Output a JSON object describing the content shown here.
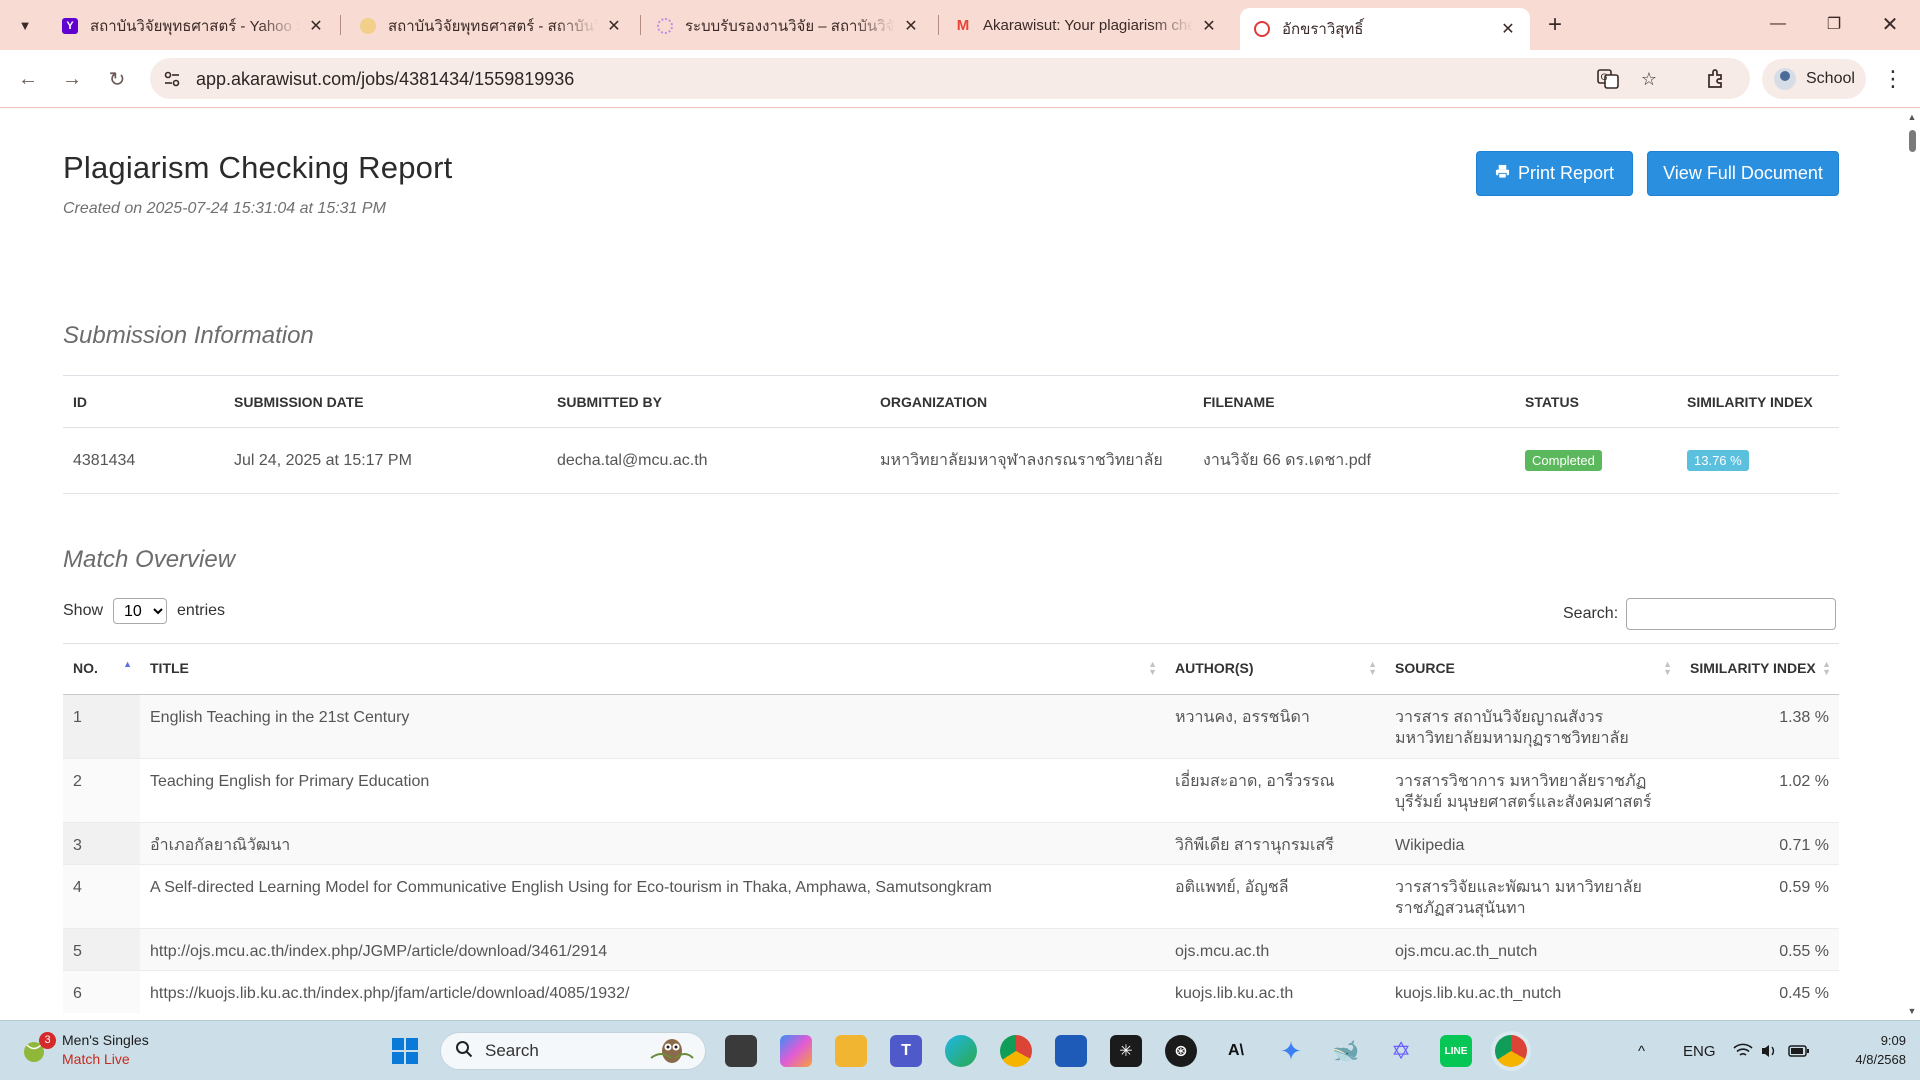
{
  "browser": {
    "tabs": [
      {
        "title": "สถาบันวิจัยพุทธศาสตร์ - Yahoo Sea",
        "favicon": "yahoo-icon",
        "color": "#5f01d1"
      },
      {
        "title": "สถาบันวิจัยพุทธศาสตร์ - สถาบันวิจัยพ",
        "favicon": "temple-icon",
        "color": "#e6b84a"
      },
      {
        "title": "ระบบรับรองงานวิจัย – สถาบันวิจัยพุท",
        "favicon": "flower-icon",
        "color": "#c58be0"
      },
      {
        "title": "Akarawisut: Your plagiarism che",
        "favicon": "gmail-icon",
        "color": "#ea4335"
      },
      {
        "title": "อักขราวิสุทธิ์",
        "favicon": "akarawisut-icon",
        "color": "#e03a3a"
      }
    ],
    "url": "app.akarawisut.com/jobs/4381434/1559819936",
    "profile_label": "School"
  },
  "report": {
    "title": "Plagiarism Checking Report",
    "created": "Created on 2025-07-24 15:31:04 at 15:31 PM",
    "print_button": "Print Report",
    "view_button": "View Full Document"
  },
  "submission": {
    "heading": "Submission Information",
    "headers": [
      "ID",
      "SUBMISSION DATE",
      "SUBMITTED BY",
      "ORGANIZATION",
      "FILENAME",
      "STATUS",
      "SIMILARITY INDEX"
    ],
    "row": {
      "id": "4381434",
      "date": "Jul 24, 2025 at 15:17 PM",
      "submitted_by": "decha.tal@mcu.ac.th",
      "organization": "มหาวิทยาลัยมหาจุฬาลงกรณราชวิทยาลัย",
      "filename": "งานวิจัย 66 ดร.เดชา.pdf",
      "status": "Completed",
      "similarity": "13.76 %"
    },
    "status_color": "#5cb85c",
    "similarity_color": "#5bc0de"
  },
  "overview": {
    "heading": "Match Overview",
    "show_label": "Show",
    "entries_value": "10",
    "entries_label": "entries",
    "search_label": "Search:",
    "headers": [
      "NO.",
      "TITLE",
      "AUTHOR(S)",
      "SOURCE",
      "SIMILARITY INDEX"
    ],
    "rows": [
      {
        "no": "1",
        "title": "English Teaching in the 21st Century",
        "authors": "หวานคง, อรรชนิดา",
        "source": "วารสาร สถาบันวิจัยญาณสังวร มหาวิทยาลัยมหามกุฏราชวิทยาลัย",
        "similarity": "1.38 %"
      },
      {
        "no": "2",
        "title": "Teaching English for Primary Education",
        "authors": "เอี่ยมสะอาด, อารีวรรณ",
        "source": "วารสารวิชาการ มหาวิทยาลัยราชภัฏบุรีรัมย์ มนุษยศาสตร์และสังคมศาสตร์",
        "similarity": "1.02 %"
      },
      {
        "no": "3",
        "title": "อำเภอกัลยาณิวัฒนา",
        "authors": "วิกิพีเดีย สารานุกรมเสรี",
        "source": "Wikipedia",
        "similarity": "0.71 %"
      },
      {
        "no": "4",
        "title": "A Self-directed Learning Model for Communicative English Using for Eco-tourism in Thaka, Amphawa, Samutsongkram",
        "authors": "อติแพทย์, อัญชลี",
        "source": "วารสารวิจัยและพัฒนา มหาวิทยาลัยราชภัฏสวนสุนันทา",
        "similarity": "0.59 %"
      },
      {
        "no": "5",
        "title": "http://ojs.mcu.ac.th/index.php/JGMP/article/download/3461/2914",
        "authors": "ojs.mcu.ac.th",
        "source": "ojs.mcu.ac.th_nutch",
        "similarity": "0.55 %"
      },
      {
        "no": "6",
        "title": "https://kuojs.lib.ku.ac.th/index.php/jfam/article/download/4085/1932/",
        "authors": "kuojs.lib.ku.ac.th",
        "source": "kuojs.lib.ku.ac.th_nutch",
        "similarity": "0.45 %"
      }
    ]
  },
  "taskbar": {
    "notify_count": "3",
    "news_title": "Men's Singles",
    "news_sub": "Match Live",
    "search_placeholder": "Search",
    "lang": "ENG",
    "time": "9:09",
    "date": "4/8/2568"
  }
}
